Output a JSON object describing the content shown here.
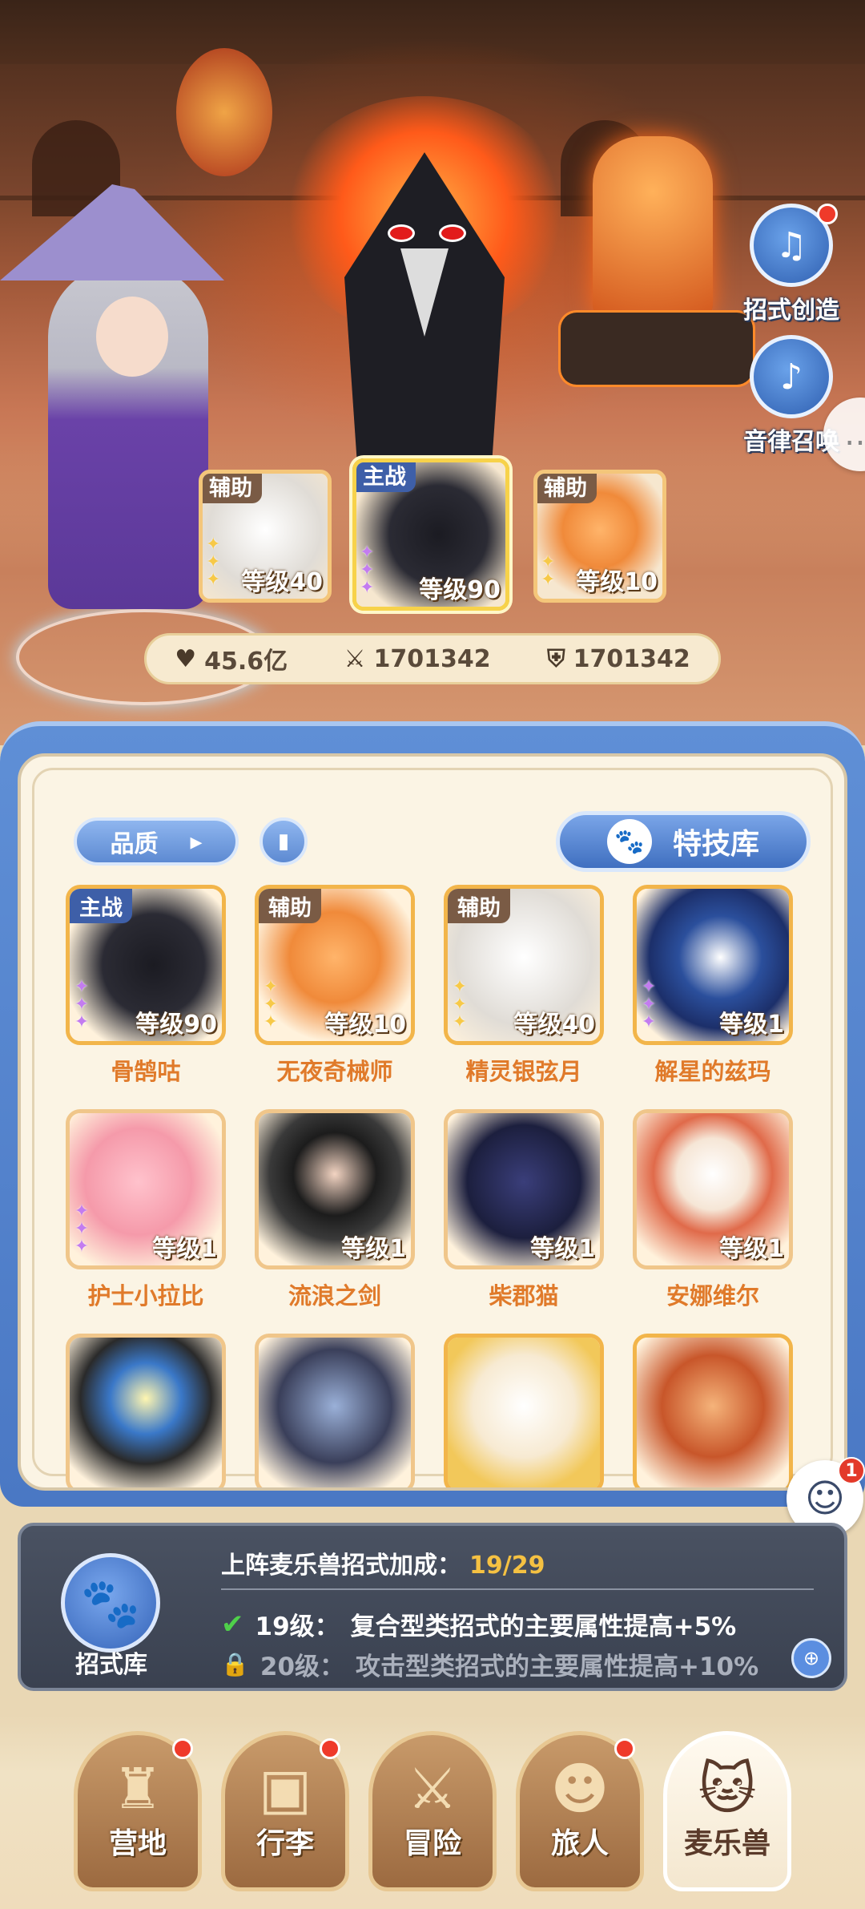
{
  "side_buttons": {
    "skill_create": "招式创造",
    "melody_summon": "音律召唤"
  },
  "team": [
    {
      "role": "辅助",
      "level": "等级40"
    },
    {
      "role": "主战",
      "level": "等级90"
    },
    {
      "role": "辅助",
      "level": "等级10"
    }
  ],
  "stats": {
    "hp": "45.6亿",
    "attack": "1701342",
    "defense": "1701342"
  },
  "roster_toolbar": {
    "quality": "品质",
    "skill_library": "特技库"
  },
  "roster": [
    {
      "name": "骨鹄咕",
      "role": "主战",
      "level": "等级90"
    },
    {
      "name": "无夜奇械师",
      "role": "辅助",
      "level": "等级10"
    },
    {
      "name": "精灵银弦月",
      "role": "辅助",
      "level": "等级40"
    },
    {
      "name": "解星的兹玛",
      "role": "",
      "level": "等级1"
    },
    {
      "name": "护士小拉比",
      "role": "",
      "level": "等级1"
    },
    {
      "name": "流浪之剑",
      "role": "",
      "level": "等级1"
    },
    {
      "name": "柴郡猫",
      "role": "",
      "level": "等级1"
    },
    {
      "name": "安娜维尔",
      "role": "",
      "level": "等级1"
    },
    {
      "name": "",
      "role": "",
      "level": ""
    },
    {
      "name": "",
      "role": "",
      "level": ""
    },
    {
      "name": "",
      "role": "",
      "level": ""
    },
    {
      "name": "",
      "role": "",
      "level": ""
    }
  ],
  "bonus": {
    "library_label": "招式库",
    "title": "上阵麦乐兽招式加成：",
    "count": "19/29",
    "unlocked_level": "19级：",
    "unlocked_text": "复合型类招式的主要属性提高+5%",
    "locked_level": "20级：",
    "locked_text": "攻击型类招式的主要属性提高+10%"
  },
  "float_badge": "1",
  "nav": [
    {
      "label": "营地",
      "icon": "castle-icon",
      "dot": true
    },
    {
      "label": "行李",
      "icon": "chest-icon",
      "dot": true
    },
    {
      "label": "冒险",
      "icon": "swords-icon",
      "dot": false
    },
    {
      "label": "旅人",
      "icon": "traveler-icon",
      "dot": true
    },
    {
      "label": "麦乐兽",
      "icon": "pet-icon",
      "dot": false,
      "active": true
    }
  ],
  "colors": {
    "accent_blue": "#4a78c4",
    "name_orange": "#e07a2a",
    "bonus_count": "#f5c142",
    "check_green": "#4fd04a",
    "notice_red": "#ef3a2a"
  }
}
